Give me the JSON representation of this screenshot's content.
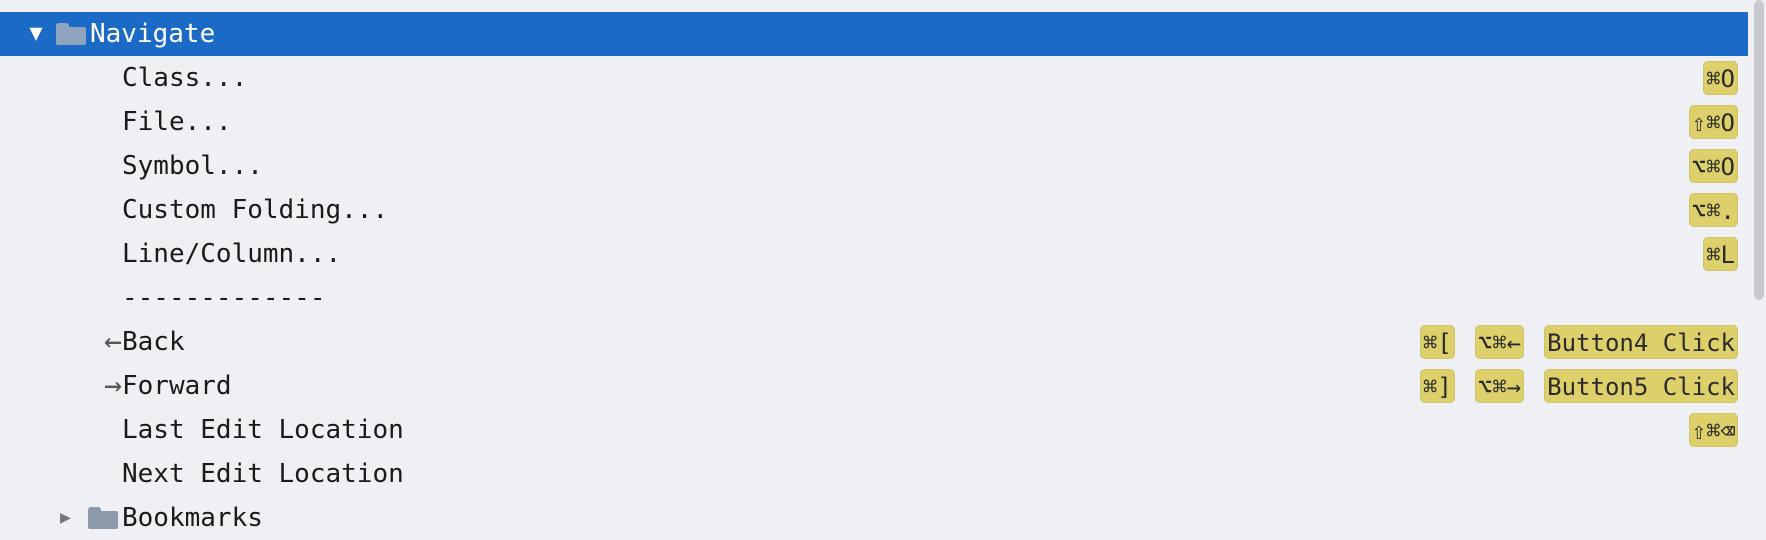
{
  "tree": {
    "group": {
      "label": "Navigate",
      "expanded_glyph": "▼",
      "icon": "folder-icon",
      "items": [
        {
          "label": "Class...",
          "shortcuts": [
            "⌘O"
          ]
        },
        {
          "label": "File...",
          "shortcuts": [
            "⇧⌘O"
          ]
        },
        {
          "label": "Symbol...",
          "shortcuts": [
            "⌥⌘O"
          ]
        },
        {
          "label": "Custom Folding...",
          "shortcuts": [
            "⌥⌘."
          ]
        },
        {
          "label": "Line/Column...",
          "shortcuts": [
            "⌘L"
          ]
        },
        {
          "label": "-------------",
          "separator": true
        },
        {
          "label": "Back",
          "icon": "arrow-left-icon",
          "glyph": "←",
          "shortcuts": [
            "⌘[",
            "⌥⌘←",
            "Button4 Click"
          ]
        },
        {
          "label": "Forward",
          "icon": "arrow-right-icon",
          "glyph": "→",
          "shortcuts": [
            "⌘]",
            "⌥⌘→",
            "Button5 Click"
          ]
        },
        {
          "label": "Last Edit Location",
          "shortcuts": [
            "⇧⌘⌫"
          ]
        },
        {
          "label": "Next Edit Location",
          "shortcuts": []
        }
      ]
    },
    "next_group": {
      "label": "Bookmarks",
      "collapsed_glyph": "▶",
      "icon": "folder-icon"
    }
  },
  "colors": {
    "selection": "#1a6ac6",
    "shortcut_bg": "#ddd06a",
    "background": "#eef0f4"
  }
}
